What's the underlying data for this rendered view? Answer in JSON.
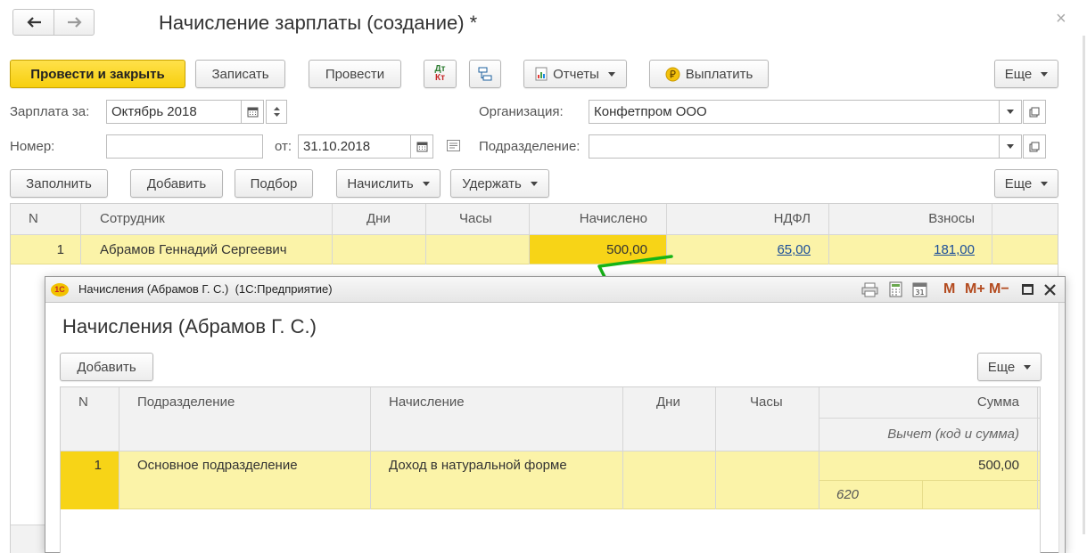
{
  "header": {
    "title": "Начисление зарплаты (создание) *",
    "close_glyph": "×"
  },
  "toolbar": {
    "post_close": "Провести и закрыть",
    "save": "Записать",
    "post": "Провести",
    "dtkt_top": "Дт",
    "dtkt_bottom": "Кт",
    "reports": "Отчеты",
    "pay": "Выплатить",
    "more": "Еще"
  },
  "form": {
    "salary_for_label": "Зарплата за:",
    "salary_for_value": "Октябрь 2018",
    "org_label": "Организация:",
    "org_value": "Конфетпром ООО",
    "number_label": "Номер:",
    "number_value": "",
    "date_label": "от:",
    "date_value": "31.10.2018",
    "dept_label": "Подразделение:",
    "dept_value": ""
  },
  "table_toolbar": {
    "fill": "Заполнить",
    "add": "Добавить",
    "pick": "Подбор",
    "accrue": "Начислить",
    "withhold": "Удержать",
    "more": "Еще"
  },
  "main_table": {
    "columns": [
      "N",
      "Сотрудник",
      "Дни",
      "Часы",
      "Начислено",
      "НДФЛ",
      "Взносы"
    ],
    "rows": [
      {
        "n": "1",
        "employee": "Абрамов Геннадий Сергеевич",
        "days": "",
        "hours": "",
        "accrued": "500,00",
        "ndfl": "65,00",
        "contrib": "181,00"
      }
    ]
  },
  "modal": {
    "titlebar": "Начисления (Абрамов Г. С.)  (1С:Предприятие)",
    "logo": "1С",
    "heading": "Начисления (Абрамов Г. С.)",
    "add": "Добавить",
    "more": "Еще",
    "title_buttons": [
      "M",
      "M+",
      "M−"
    ],
    "columns": {
      "n": "N",
      "dept": "Подразделение",
      "accrual": "Начисление",
      "days": "Дни",
      "hours": "Часы",
      "sum": "Сумма",
      "deduction": "Вычет (код и сумма)"
    },
    "rows": [
      {
        "n": "1",
        "dept": "Основное подразделение",
        "accrual": "Доход в натуральной форме",
        "days": "",
        "hours": "",
        "sum": "500,00",
        "deduction_code": "620",
        "deduction_sum": ""
      }
    ]
  },
  "colors": {
    "accent_yellow": "#f7cf0e",
    "row_highlight": "#fbf3a8",
    "selected_cell": "#f7d417",
    "annotation_green": "#16b316",
    "link": "#1b4e99"
  }
}
